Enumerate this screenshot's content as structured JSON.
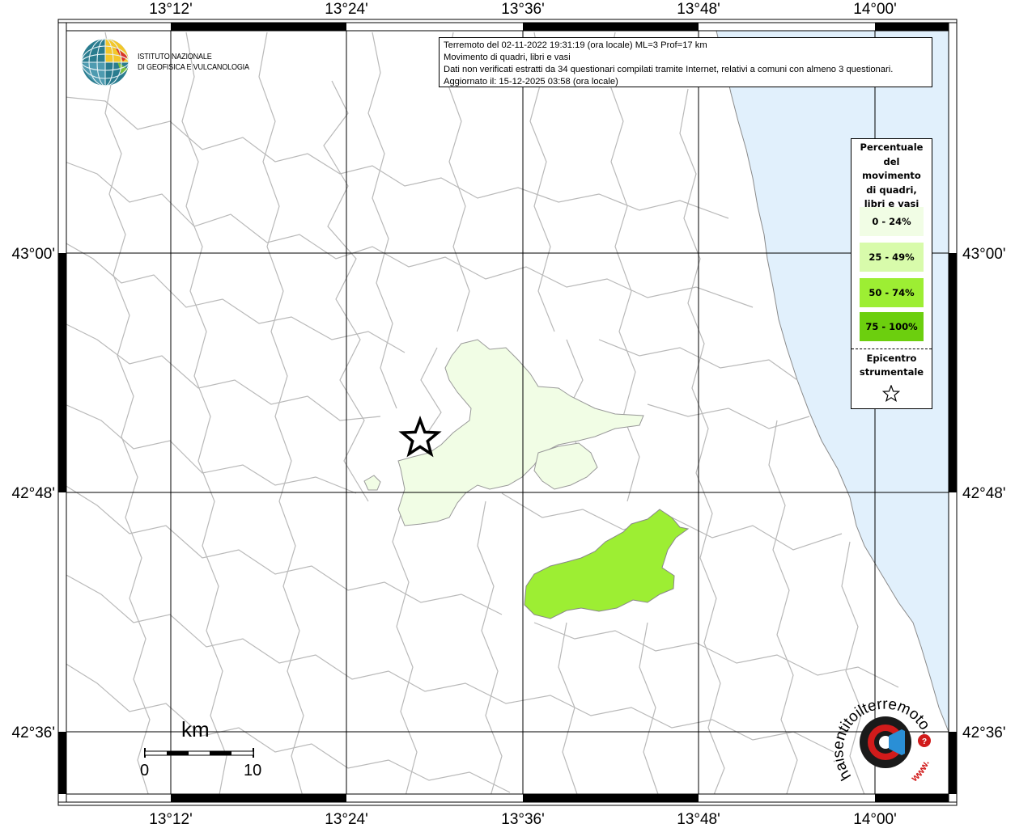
{
  "map": {
    "info": {
      "line1": "Terremoto del 02-11-2022 19:31:19 (ora locale) ML=3 Prof=17 km",
      "line2": "Movimento di quadri, libri e vasi",
      "line3": "Dati non verificati estratti da 34 questionari compilati tramite Internet, relativi a comuni con almeno 3 questionari.",
      "line4": "Aggiornato il: 15-12-2025 03:58 (ora locale)"
    },
    "longitude_ticks": [
      "13°12'",
      "13°24'",
      "13°36'",
      "13°48'",
      "14°00'"
    ],
    "latitude_ticks": [
      "43°00'",
      "42°48'",
      "42°36'"
    ],
    "legend": {
      "title": "Percentuale\ndel\nmovimento\ndi quadri,\nlibri e vasi",
      "classes": [
        {
          "label": "0 - 24%",
          "color": "#f1fde5"
        },
        {
          "label": "25 - 49%",
          "color": "#d8fbab"
        },
        {
          "label": "50 - 74%",
          "color": "#9dee33"
        },
        {
          "label": "75 - 100%",
          "color": "#6ccf0e"
        }
      ],
      "epicenter_label": "Epicentro\nstrumentale"
    },
    "scale": {
      "unit": "km",
      "start": "0",
      "end": "10"
    },
    "ingv_logo": {
      "line1": "ISTITUTO NAZIONALE",
      "line2": "DI GEOFISICA E VULCANOLOGIA"
    },
    "hst_logo": {
      "text": "haisentitoilterremoto.it",
      "url_text": "www."
    },
    "colors": {
      "sea": "#e1f0fc",
      "boundary": "#b9b9b9",
      "grid": "#000000"
    }
  }
}
